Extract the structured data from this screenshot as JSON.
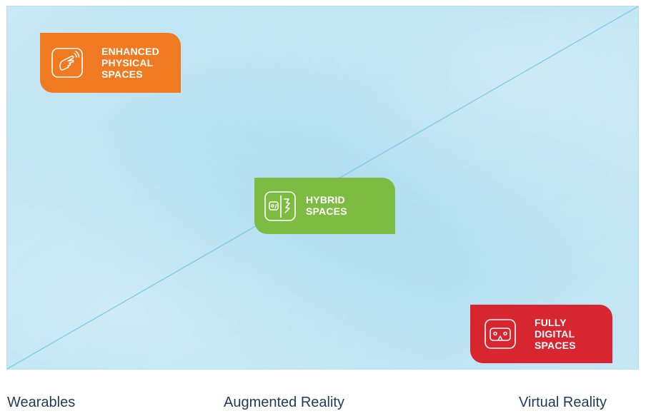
{
  "diagram": {
    "badges": [
      {
        "label": "ENHANCED\nPHYSICAL\nSPACES",
        "color": "#f07a22",
        "icon": "pointing-hand-icon"
      },
      {
        "label": "HYBRID\nSPACES",
        "color": "#7ebb42",
        "icon": "hybrid-face-icon"
      },
      {
        "label": "FULLY\nDIGITAL\nSPACES",
        "color": "#d7262f",
        "icon": "vr-headset-icon"
      }
    ],
    "axis_labels": {
      "left": "Wearables",
      "middle": "Augmented Reality",
      "right": "Virtual Reality"
    },
    "colors": {
      "background": "#bfe5f4",
      "diagonal_line": "#7cc7e6",
      "text": "#1f3a5a"
    }
  }
}
